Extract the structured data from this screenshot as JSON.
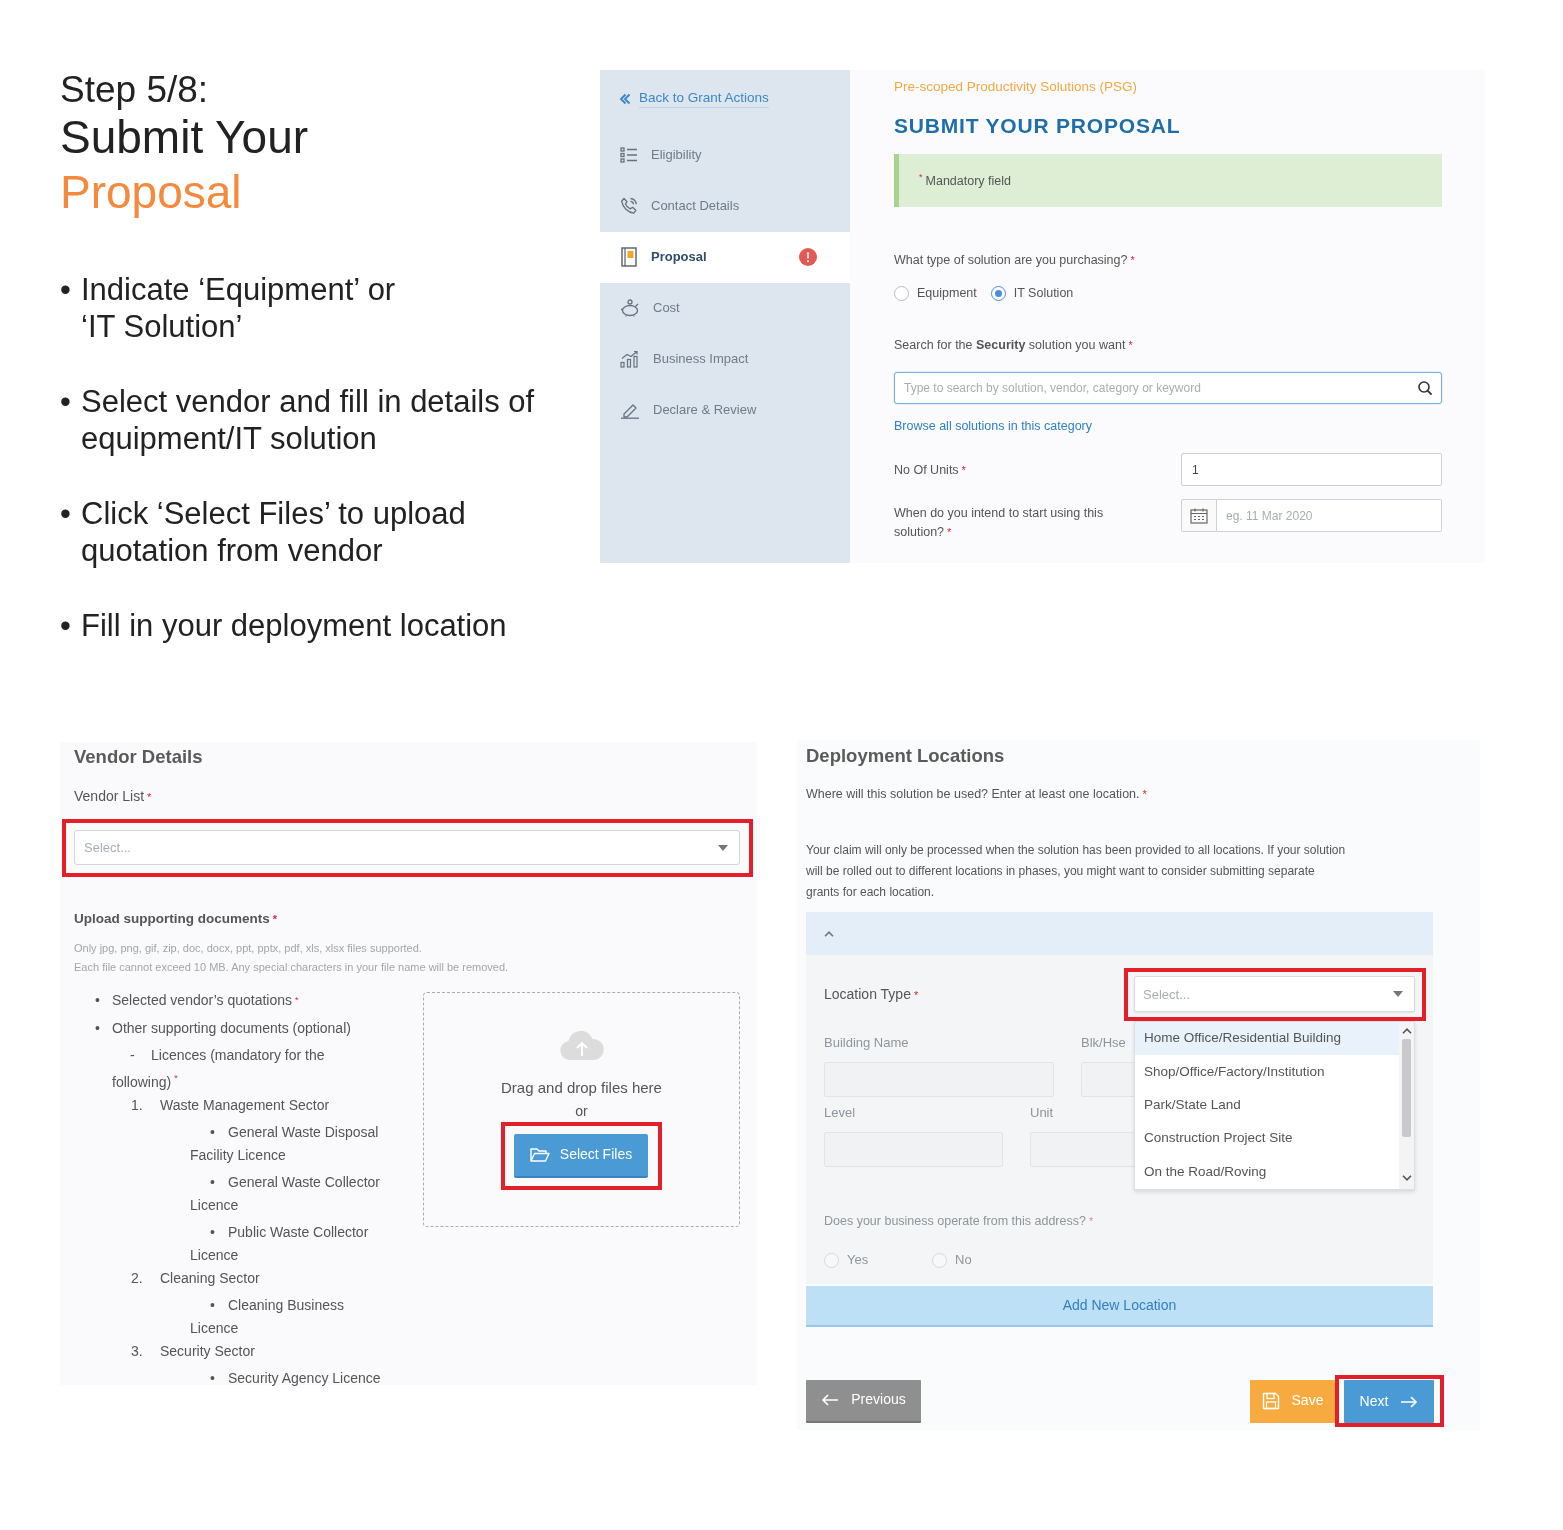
{
  "intro": {
    "step": "Step 5/8:",
    "title": "Submit Your",
    "title_accent": "Proposal",
    "bullets": [
      {
        "marker": "•",
        "text": "Indicate ‘Equipment’ or\n‘IT Solution’"
      },
      {
        "marker": "•",
        "text": "Select vendor and fill in details of\nequipment/IT solution"
      },
      {
        "marker": "•",
        "text": "Click ‘Select Files’ to upload\nquotation from vendor"
      },
      {
        "marker": "•",
        "text": "Fill in your deployment location"
      }
    ]
  },
  "proposal_screen": {
    "sidebar": {
      "back_link": "Back to Grant Actions",
      "items": [
        {
          "label": "Eligibility",
          "selected": false,
          "alert": false
        },
        {
          "label": "Contact Details",
          "selected": false,
          "alert": false
        },
        {
          "label": "Proposal",
          "selected": true,
          "alert": true
        },
        {
          "label": "Cost",
          "selected": false,
          "alert": false
        },
        {
          "label": "Business Impact",
          "selected": false,
          "alert": false
        },
        {
          "label": "Declare & Review",
          "selected": false,
          "alert": false
        }
      ]
    },
    "program": "Pre-scoped Productivity Solutions (PSG)",
    "title": "SUBMIT YOUR PROPOSAL",
    "notice": {
      "mark": "*",
      "text": "Mandatory field"
    },
    "solution_type": {
      "label": "What type of solution are you purchasing?",
      "mark": "*",
      "options": [
        {
          "label": "Equipment",
          "selected": false
        },
        {
          "label": "IT Solution",
          "selected": true
        }
      ]
    },
    "search": {
      "label": "Search for the **Security** solution you want",
      "mark": "*",
      "placeholder": "Type to search by solution, vendor, category or keyword"
    },
    "browse_link": "Browse all solutions in this category",
    "units": {
      "label": "No Of Units",
      "mark": "*",
      "value": "1"
    },
    "start_date": {
      "label": "When do you intend to start using this solution?",
      "mark": "*",
      "placeholder": "eg. 11 Mar 2020"
    }
  },
  "vendor_screen": {
    "title": "Vendor Details",
    "vendor_list": {
      "label": "Vendor List",
      "mark": "*",
      "placeholder": "Select...",
      "highlighted": true
    },
    "upload": {
      "label": "Upload supporting documents",
      "mark": "*",
      "hints": [
        "Only jpg, png, gif, zip, doc, docx, ppt, pptx, pdf, xls, xlsx files supported.",
        "Each file cannot exceed 10 MB. Any special characters in your file name will be removed."
      ],
      "documents": [
        {
          "marker": "•",
          "text": "Selected vendor’s quotations",
          "mark": "*"
        },
        {
          "marker": "•",
          "text": "Other supporting documents (optional)",
          "children": [
            {
              "marker": "-",
              "text": "Licences (mandatory for the\nfollowing)",
              "mark": "*",
              "children": [
                {
                  "marker": "1.",
                  "text": "Waste Management Sector",
                  "children": [
                    {
                      "marker": "•",
                      "text": "General Waste Disposal\nFacility Licence"
                    },
                    {
                      "marker": "•",
                      "text": "General Waste Collector\nLicence"
                    },
                    {
                      "marker": "•",
                      "text": "Public Waste Collector\nLicence"
                    }
                  ]
                },
                {
                  "marker": "2.",
                  "text": "Cleaning Sector",
                  "children": [
                    {
                      "marker": "•",
                      "text": "Cleaning Business\nLicence"
                    }
                  ]
                },
                {
                  "marker": "3.",
                  "text": "Security Sector",
                  "children": [
                    {
                      "marker": "•",
                      "text": "Security Agency Licence"
                    }
                  ]
                }
              ]
            }
          ]
        }
      ],
      "dropzone": {
        "text": "Drag and drop files here",
        "separator": "or",
        "button": {
          "label": "Select Files",
          "highlighted": true
        }
      }
    }
  },
  "deployment_screen": {
    "title": "Deployment Locations",
    "question": {
      "label": "Where will this solution be used? Enter at least one location.",
      "mark": "*"
    },
    "note": "Your claim will only be processed when the solution has been provided to all locations. If your solution\nwill be rolled out to different locations in phases, you might want to consider submitting separate\ngrants for each location.",
    "location": {
      "expanded": true,
      "location_type": {
        "label": "Location Type",
        "mark": "*",
        "placeholder": "Select...",
        "highlighted": true,
        "open": true,
        "options": [
          {
            "label": "Home Office/Residential Building",
            "selected": true
          },
          {
            "label": "Shop/Office/Factory/Institution",
            "selected": false
          },
          {
            "label": "Park/State Land",
            "selected": false
          },
          {
            "label": "Construction Project Site",
            "selected": false
          },
          {
            "label": "On the Road/Roving",
            "selected": false
          }
        ]
      },
      "fields": [
        {
          "label": "Building Name",
          "disabled": true
        },
        {
          "label": "Blk/Hse",
          "disabled": true
        },
        {
          "label": "Level",
          "disabled": true
        },
        {
          "label": "Unit",
          "disabled": true
        }
      ],
      "operate": {
        "label": "Does your business operate from this address?",
        "mark": "*",
        "disabled": true,
        "options": [
          {
            "label": "Yes",
            "selected": false
          },
          {
            "label": "No",
            "selected": false
          }
        ]
      }
    },
    "add_button": "Add New Location",
    "actions": [
      {
        "kind": "previous",
        "label": "Previous",
        "highlighted": false
      },
      {
        "kind": "save",
        "label": "Save",
        "highlighted": false
      },
      {
        "kind": "next",
        "label": "Next",
        "highlighted": true
      }
    ]
  }
}
